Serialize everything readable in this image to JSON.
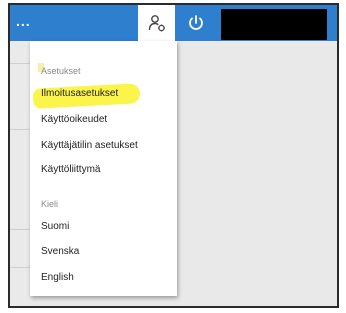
{
  "topbar": {
    "menu_dots": "...",
    "user_icon": "user-switch-icon",
    "power_icon": "power-icon",
    "accent_color": "#2f7fcf"
  },
  "menu": {
    "settings_header": "Asetukset",
    "settings_items": [
      {
        "label": "Ilmoitusasetukset",
        "highlighted": true
      },
      {
        "label": "Käyttöoikeudet"
      },
      {
        "label": "Käyttäjätilin asetukset"
      },
      {
        "label": "Käyttöliittymä"
      }
    ],
    "language_header": "Kieli",
    "language_items": [
      {
        "label": "Suomi"
      },
      {
        "label": "Svenska"
      },
      {
        "label": "English"
      }
    ],
    "highlight_color": "#fbf44a"
  }
}
